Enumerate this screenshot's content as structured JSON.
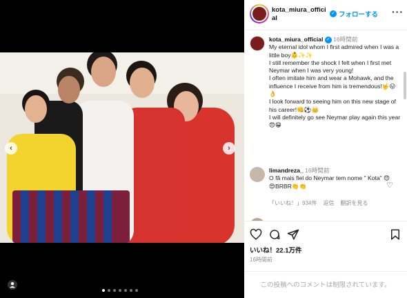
{
  "header": {
    "username": "kota_miura_official",
    "follow_label": "フォローする",
    "more_label": "···"
  },
  "caption": {
    "username": "kota_miura_official",
    "time": "16時間前",
    "lines": [
      "My eternal idol whom I first admired when I was a little boy👶✨✨",
      "I still remember the shock I felt when I first met Neymar when I was very young!",
      "I often imitate him and wear a Mohawk, and the influence I receive from him is tremendous!🤟😛👌",
      "I look forward to seeing him on this new stage of his career!👊⚽👑",
      "I will definitely go see Neymar play again this year😍😁"
    ]
  },
  "comment": {
    "username": "limandreza_",
    "time": "16時間前",
    "text": "O fã mais fiel do Neymar tem nome \" Kota\" 😍😍BRBR👏👏",
    "likes": "「いいね！」934件",
    "reply_label": "返信",
    "translate_label": "翻訳を見る"
  },
  "actions": {
    "likes": "いいね！22.1万件",
    "time": "16時間前",
    "comments_disabled": "この投稿へのコメントは制限されています。"
  },
  "carousel": {
    "prev": "‹",
    "next": "›",
    "slide_count": 7,
    "active_index": 0
  },
  "icons": {
    "heart": "heart-icon",
    "comment": "comment-icon",
    "share": "share-icon",
    "save": "bookmark-icon",
    "verified": "verified-badge-icon",
    "tag": "user-tag-icon"
  },
  "colors": {
    "accent": "#0095f6",
    "muted": "#8e8e8e",
    "background": "#000000"
  }
}
